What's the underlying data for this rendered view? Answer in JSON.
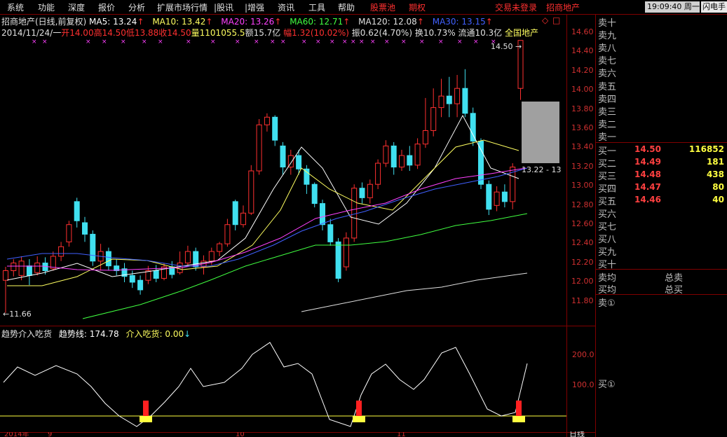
{
  "menu": {
    "items": [
      "系统",
      "功能",
      "深度",
      "报价",
      "分析",
      "扩展市场行情",
      "|股讯",
      "|增强",
      "资讯",
      "工具",
      "帮助"
    ],
    "red_items": [
      "股票池",
      "期权"
    ],
    "login_status": "交易未登录",
    "broker": "招商地产",
    "clock": "19:09:40 周一",
    "flash": "闪电手"
  },
  "header": {
    "title_line_prefix": "招商地产(日线,前复权)",
    "ma5": "MA5: 13.24",
    "ma10": "MA10: 13.42",
    "ma20": "MA20: 13.26",
    "ma60": "MA60: 12.71",
    "ma120": "MA120: 12.08",
    "ma30": "MA30: 13.15",
    "diamond": "◇",
    "close_box": "□",
    "line2": {
      "date": "2014/11/24/一",
      "open": "开14.00",
      "high": "高14.50",
      "low": "低13.88",
      "close": "收14.50",
      "volume": "量1101055.5",
      "amount": "额15.7亿",
      "change": "幅1.32(10.02%)",
      "amplitude": "振0.62(4.70%)",
      "turnover": "换10.73%",
      "float": "流通10.3亿",
      "sector": "全国地产"
    }
  },
  "price_axis": {
    "labels": [
      "14.60",
      "14.40",
      "14.20",
      "14.00",
      "13.80",
      "13.60",
      "13.40",
      "13.20",
      "13.00",
      "12.80",
      "12.60",
      "12.40",
      "12.20",
      "12.00",
      "11.80"
    ]
  },
  "annotations": {
    "high_marker": "14.50",
    "low_marker": "11.66",
    "cursor_price": "13.22 - 13"
  },
  "indicator": {
    "name": "趋势介入吃货",
    "trend_label": "趋势线: 174.78",
    "buy_label": "介入吃货: 0.00",
    "axis_labels": [
      "200.0",
      "100.0"
    ]
  },
  "order_book": {
    "sell": [
      "卖十",
      "卖九",
      "卖八",
      "卖七",
      "卖六",
      "卖五",
      "卖四",
      "卖三",
      "卖二",
      "卖一"
    ],
    "buy": [
      {
        "label": "买一",
        "price": "14.50",
        "vol": "116852"
      },
      {
        "label": "买二",
        "price": "14.49",
        "vol": "181"
      },
      {
        "label": "买三",
        "price": "14.48",
        "vol": "438"
      },
      {
        "label": "买四",
        "price": "14.47",
        "vol": "80"
      },
      {
        "label": "买五",
        "price": "14.46",
        "vol": "40"
      },
      {
        "label": "买六",
        "price": "",
        "vol": ""
      },
      {
        "label": "买七",
        "price": "",
        "vol": ""
      },
      {
        "label": "买八",
        "price": "",
        "vol": ""
      },
      {
        "label": "买九",
        "price": "",
        "vol": ""
      },
      {
        "label": "买十",
        "price": "",
        "vol": ""
      }
    ],
    "sell_avg": "卖均",
    "buy_avg": "买均",
    "total_sell": "总卖",
    "total_buy": "总买",
    "sell_1_circled": "卖①",
    "buy_1_circled": "买①"
  },
  "footer": {
    "date_left": "2014年",
    "tick_9": "9",
    "tick_10": "10",
    "tick_11": "11",
    "period": "日线"
  },
  "colors": {
    "up": "#ff3030",
    "down": "#40e0f0",
    "ma5": "#ffffff",
    "ma10": "#ffff60",
    "ma20": "#ff40ff",
    "ma60": "#40ff40",
    "ma120": "#e0e0e0",
    "ma30": "#4060ff",
    "grid": "#800000"
  }
}
